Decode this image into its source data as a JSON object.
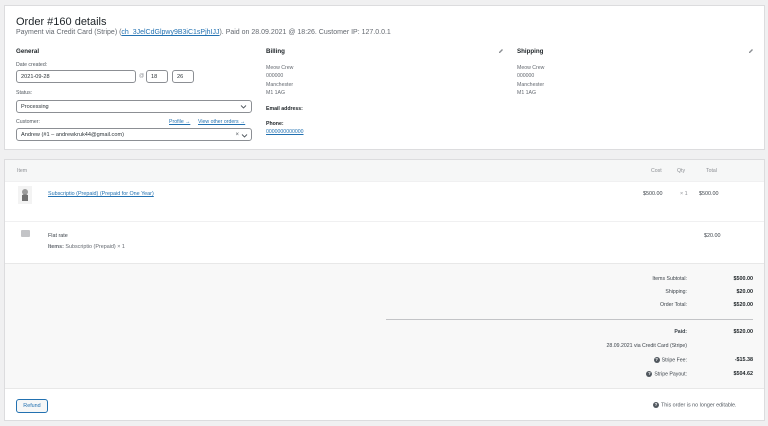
{
  "order": {
    "title": "Order #160 details",
    "meta_prefix": "Payment via Credit Card (Stripe) (",
    "charge_id": "ch_3JelCdGlpwy9B3iC1sPjhIJJ",
    "meta_suffix": "). Paid on 28.09.2021 @ 18:26. Customer IP: 127.0.0.1"
  },
  "general": {
    "heading": "General",
    "date_label": "Date created:",
    "date_value": "2021-09-28",
    "at_symbol": "@",
    "hour": "18",
    "minute": "26",
    "status_label": "Status:",
    "status_value": "Processing",
    "customer_label": "Customer:",
    "profile_link": "Profile →",
    "other_orders_link": "View other orders →",
    "customer_value": "Andrew (#1 – andrewkruk44@gmail.com)",
    "clear_symbol": "×"
  },
  "billing": {
    "heading": "Billing",
    "address": [
      "Meow Crew",
      "000000",
      "Manchester",
      "M1 1AG"
    ],
    "email_label": "Email address:",
    "phone_label": "Phone:",
    "phone_value": "0000000000000"
  },
  "shipping": {
    "heading": "Shipping",
    "address": [
      "Meow Crew",
      "000000",
      "Manchester",
      "M1 1AG"
    ]
  },
  "items_table": {
    "headers": {
      "item": "Item",
      "cost": "Cost",
      "qty": "Qty",
      "total": "Total"
    },
    "line_item": {
      "name": "Subscriptio (Prepaid) (Prepaid for One Year)",
      "cost": "$500.00",
      "qty": "× 1",
      "total": "$500.00"
    },
    "shipping_line": {
      "name": "Flat rate",
      "items_label": "Items:",
      "items_value": "Subscriptio (Prepaid) × 1",
      "total": "$20.00"
    }
  },
  "totals": {
    "subtotal_label": "Items Subtotal:",
    "subtotal_value": "$500.00",
    "shipping_label": "Shipping:",
    "shipping_value": "$20.00",
    "order_total_label": "Order Total:",
    "order_total_value": "$520.00",
    "paid_label": "Paid:",
    "paid_value": "$520.00",
    "paid_note": "28.09.2021 via Credit Card (Stripe)",
    "fee_label": "Stripe Fee:",
    "fee_value": "-$15.38",
    "payout_label": "Stripe Payout:",
    "payout_value": "$504.62"
  },
  "footer": {
    "refund_button": "Refund",
    "not_editable_note": "This order is no longer editable."
  },
  "colors": {
    "link": "#2271b1",
    "border": "#dcdcde",
    "text": "#3c434a"
  }
}
